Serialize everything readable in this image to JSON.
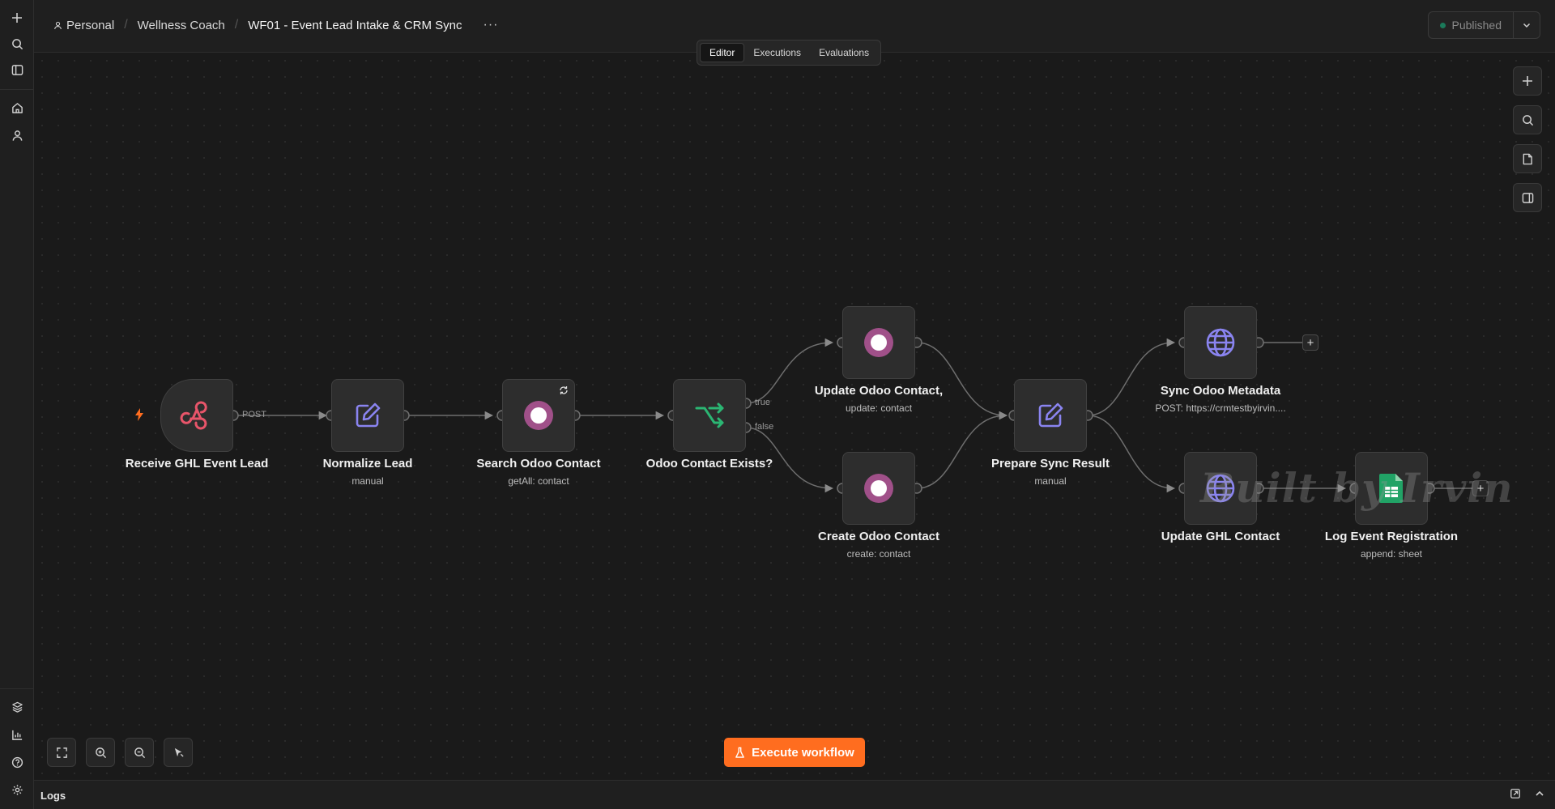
{
  "breadcrumb": {
    "project": "Personal",
    "folder": "Wellness Coach",
    "workflow": "WF01 - Event Lead Intake & CRM Sync",
    "more": "···"
  },
  "publish": {
    "label": "Published",
    "status_color": "#1b7a5a"
  },
  "tabs": [
    {
      "label": "Editor",
      "active": true
    },
    {
      "label": "Executions",
      "active": false
    },
    {
      "label": "Evaluations",
      "active": false
    }
  ],
  "nodes": {
    "receive_ghl_event_lead": {
      "title": "Receive GHL Event Lead",
      "subtitle": "",
      "icon": "webhook-icon"
    },
    "normalize_lead": {
      "title": "Normalize Lead",
      "subtitle": "manual",
      "icon": "edit-fields-icon"
    },
    "search_odoo_contact": {
      "title": "Search Odoo Contact",
      "subtitle": "getAll: contact",
      "icon": "odoo-icon"
    },
    "odoo_contact_exists": {
      "title": "Odoo Contact Exists?",
      "subtitle": "",
      "icon": "if-branch-icon"
    },
    "update_odoo_contact": {
      "title": "Update Odoo Contact,",
      "subtitle": "update: contact",
      "icon": "odoo-icon"
    },
    "create_odoo_contact": {
      "title": "Create Odoo Contact",
      "subtitle": "create: contact",
      "icon": "odoo-icon"
    },
    "prepare_sync_result": {
      "title": "Prepare Sync Result",
      "subtitle": "manual",
      "icon": "edit-fields-icon"
    },
    "sync_odoo_metadata": {
      "title": "Sync Odoo Metadata",
      "subtitle": "POST: https://crmtestbyirvin....",
      "icon": "globe-icon"
    },
    "update_ghl_contact": {
      "title": "Update GHL Contact",
      "subtitle": "",
      "icon": "globe-icon"
    },
    "log_event_registration": {
      "title": "Log Event Registration",
      "subtitle": "append: sheet",
      "icon": "google-sheets-icon"
    }
  },
  "edge_labels": {
    "post": "POST",
    "true": "true",
    "false": "false"
  },
  "watermark": "Built by Irvin",
  "execute_button": {
    "label": "Execute workflow"
  },
  "logs": {
    "label": "Logs"
  },
  "colors": {
    "accent": "#ff6d1f",
    "webhook": "#e8556a",
    "edit": "#8a84f0",
    "odoo": "#a05089",
    "if": "#2bb673",
    "globe": "#8a84f0",
    "sheets": "#21a366"
  }
}
